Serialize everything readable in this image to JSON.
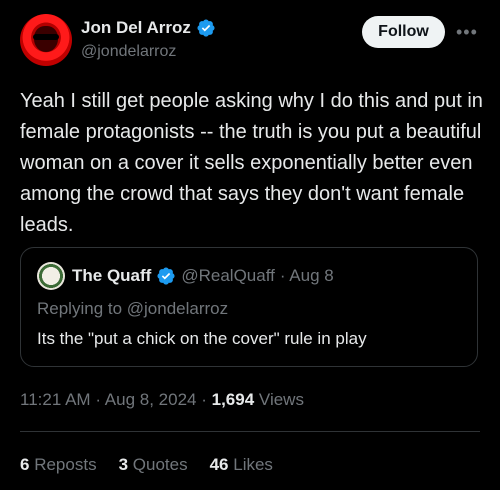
{
  "author": {
    "display_name": "Jon Del Arroz",
    "handle": "@jondelarroz",
    "verified_icon": "verified-badge-icon"
  },
  "actions": {
    "follow_label": "Follow",
    "more_label": "•••"
  },
  "tweet": {
    "text": "Yeah I still get people asking why I do this and put in female protagonists -- the truth is you put a beautiful woman on a cover it sells exponentially better even among the crowd that says they don't want female leads."
  },
  "quote": {
    "display_name": "The Quaff",
    "handle": "@RealQuaff",
    "date": "· Aug 8",
    "replying_to": "Replying to @jondelarroz",
    "text": "Its the \"put a chick on the cover\" rule in play"
  },
  "meta": {
    "time": "11:21 AM",
    "separator1": "·",
    "date": "Aug 8, 2024",
    "separator2": "·",
    "views_count": "1,694",
    "views_label": "Views"
  },
  "stats": {
    "reposts_count": "6",
    "reposts_label": "Reposts",
    "quotes_count": "3",
    "quotes_label": "Quotes",
    "likes_count": "46",
    "likes_label": "Likes"
  },
  "colors": {
    "background": "#000000",
    "verified": "#1d9bf0",
    "text_primary": "#e7e9ea",
    "text_secondary": "#71767b",
    "border": "#2f3336"
  }
}
